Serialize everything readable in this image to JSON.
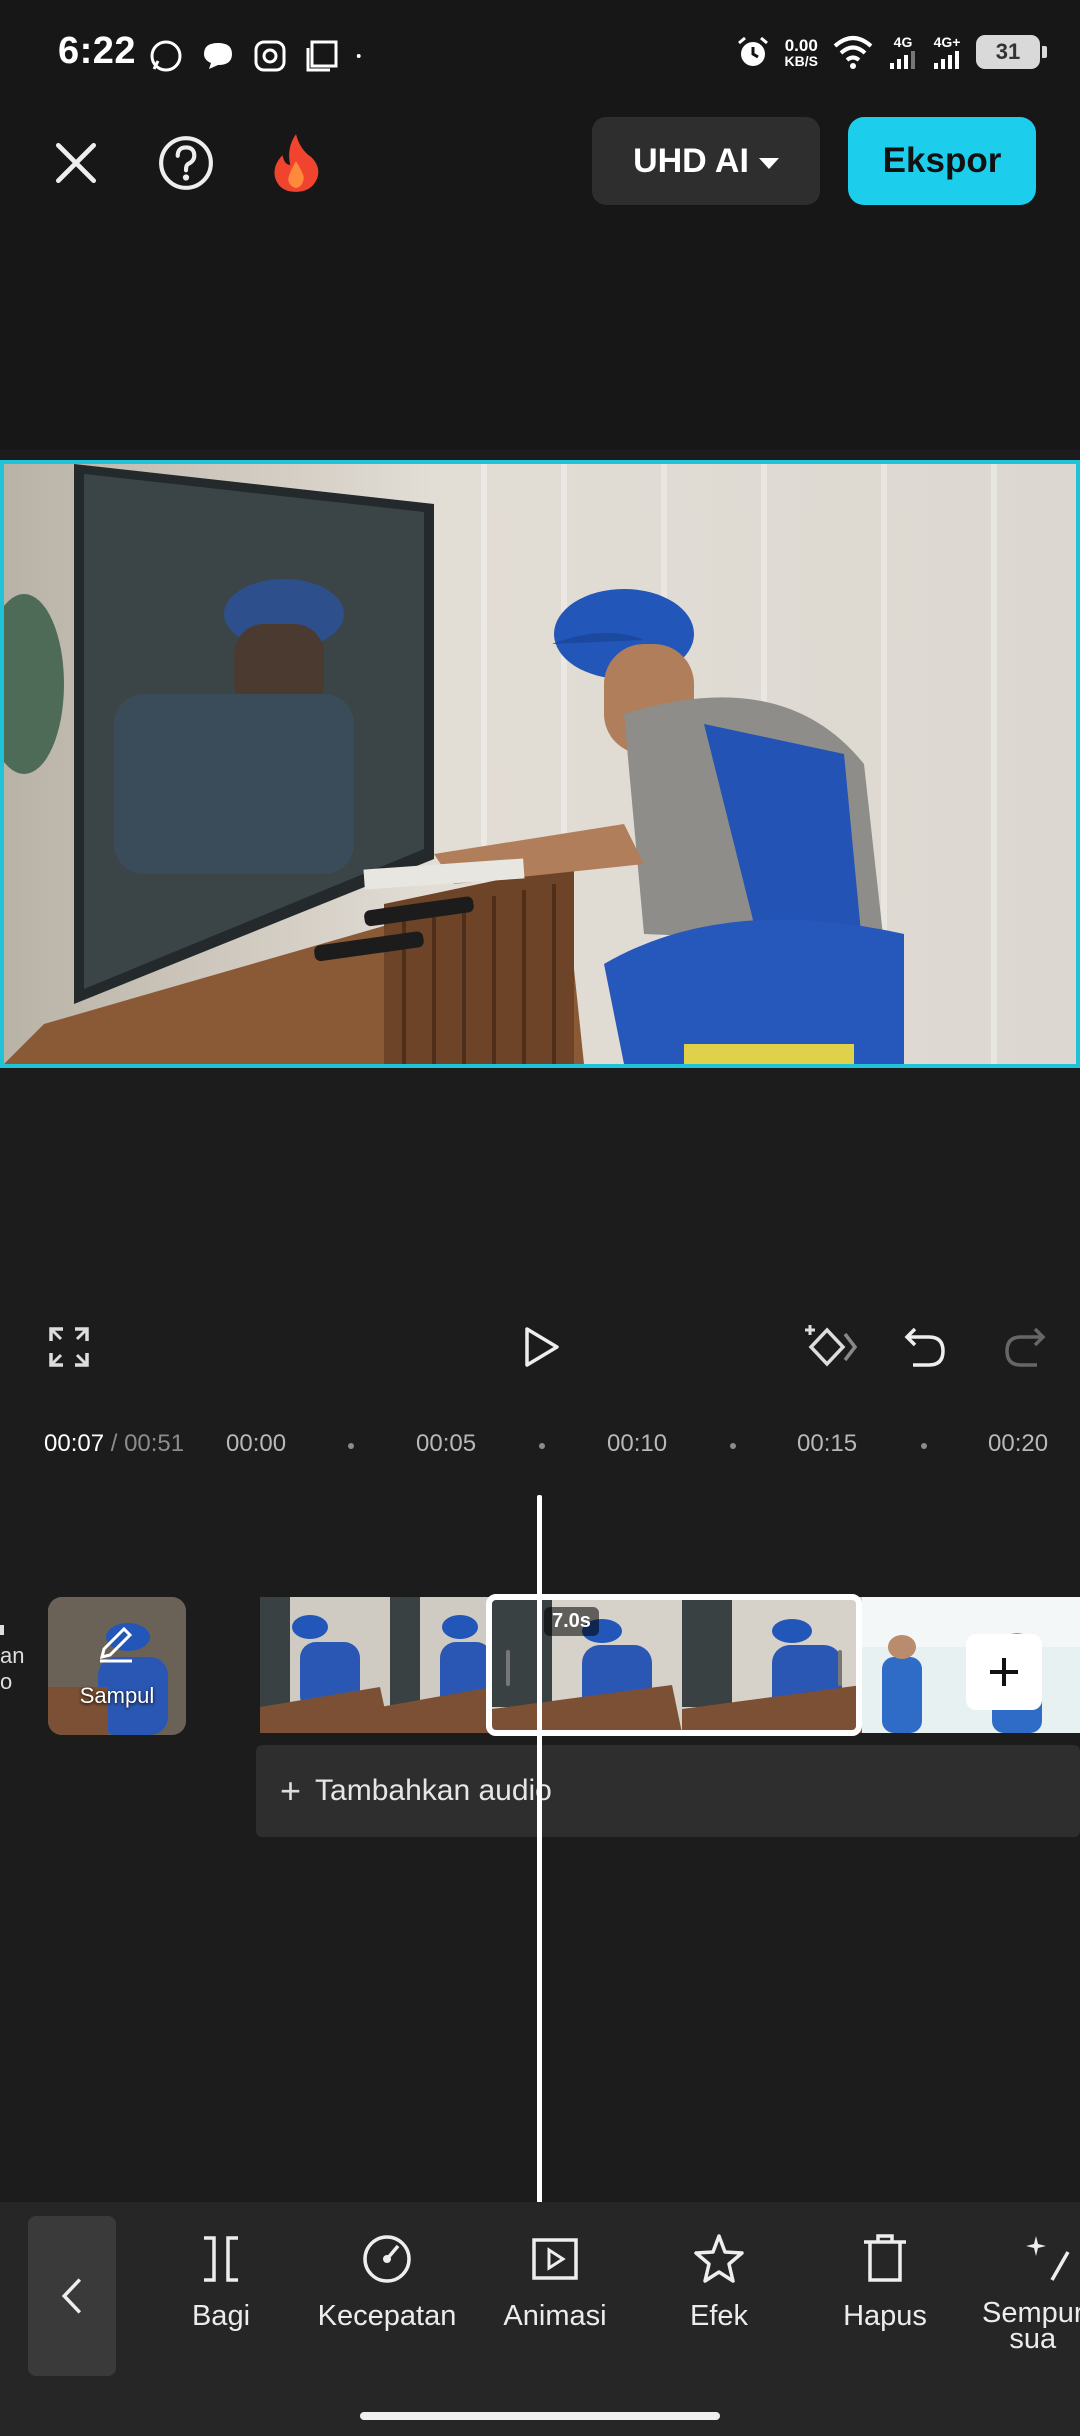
{
  "status_bar": {
    "time": "6:22",
    "net_speed_value": "0.00",
    "net_speed_unit": "KB/S",
    "signal1": "4G",
    "signal2": "4G+",
    "battery": "31"
  },
  "header": {
    "quality_label": "UHD AI",
    "export_label": "Ekspor"
  },
  "timeline": {
    "current": "00:07",
    "total": "/ 00:51",
    "ticks": [
      "00:00",
      "00:05",
      "00:10",
      "00:15",
      "00:20"
    ],
    "cover_label": "Sampul",
    "left_cut_text": "an\no",
    "clip_duration": "7.0s",
    "add_audio_label": "Tambahkan audio"
  },
  "bottom_tools": [
    {
      "label": "Bagi",
      "icon": "split-icon"
    },
    {
      "label": "Kecepatan",
      "icon": "speed-icon"
    },
    {
      "label": "Animasi",
      "icon": "animation-icon"
    },
    {
      "label": "Efek",
      "icon": "effects-icon"
    },
    {
      "label": "Hapus",
      "icon": "delete-icon"
    },
    {
      "label": "Sempur\nsua",
      "icon": "magic-icon"
    }
  ],
  "colors": {
    "accent": "#1ccdec",
    "selection_border": "#1fc2d6",
    "background": "#1c1c1c"
  }
}
